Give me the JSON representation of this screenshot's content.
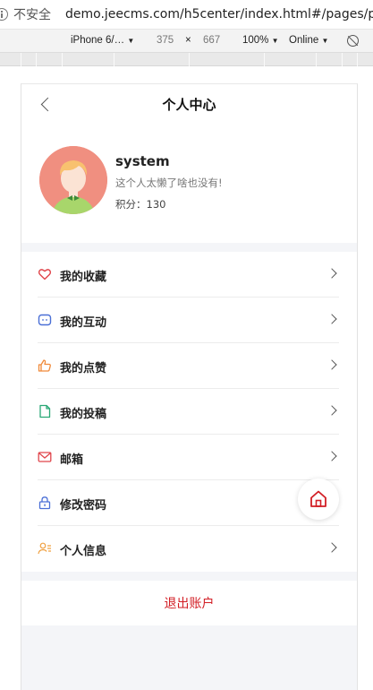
{
  "browser": {
    "insecure_label": "不安全",
    "url": "demo.jeecms.com/h5center/index.html#/pages/pers"
  },
  "device_toolbar": {
    "device": "iPhone 6/…",
    "width": "375",
    "times": "×",
    "height": "667",
    "zoom": "100%",
    "network": "Online",
    "caret": "▼"
  },
  "header": {
    "title": "个人中心"
  },
  "profile": {
    "username": "system",
    "bio": "这个人太懒了啥也没有!",
    "points": "积分：130"
  },
  "menu": {
    "items": [
      {
        "label": "我的收藏",
        "icon": "heart-icon",
        "color": "#e0454b"
      },
      {
        "label": "我的互动",
        "icon": "chat-icon",
        "color": "#4a6fd6"
      },
      {
        "label": "我的点赞",
        "icon": "thumb-up-icon",
        "color": "#f08a3a"
      },
      {
        "label": "我的投稿",
        "icon": "document-icon",
        "color": "#2aa876"
      },
      {
        "label": "邮箱",
        "icon": "mail-icon",
        "color": "#e0454b"
      },
      {
        "label": "修改密码",
        "icon": "lock-icon",
        "color": "#4a6fd6"
      },
      {
        "label": "个人信息",
        "icon": "user-info-icon",
        "color": "#f0a040"
      }
    ]
  },
  "logout": {
    "label": "退出账户",
    "color": "#d21e25"
  }
}
